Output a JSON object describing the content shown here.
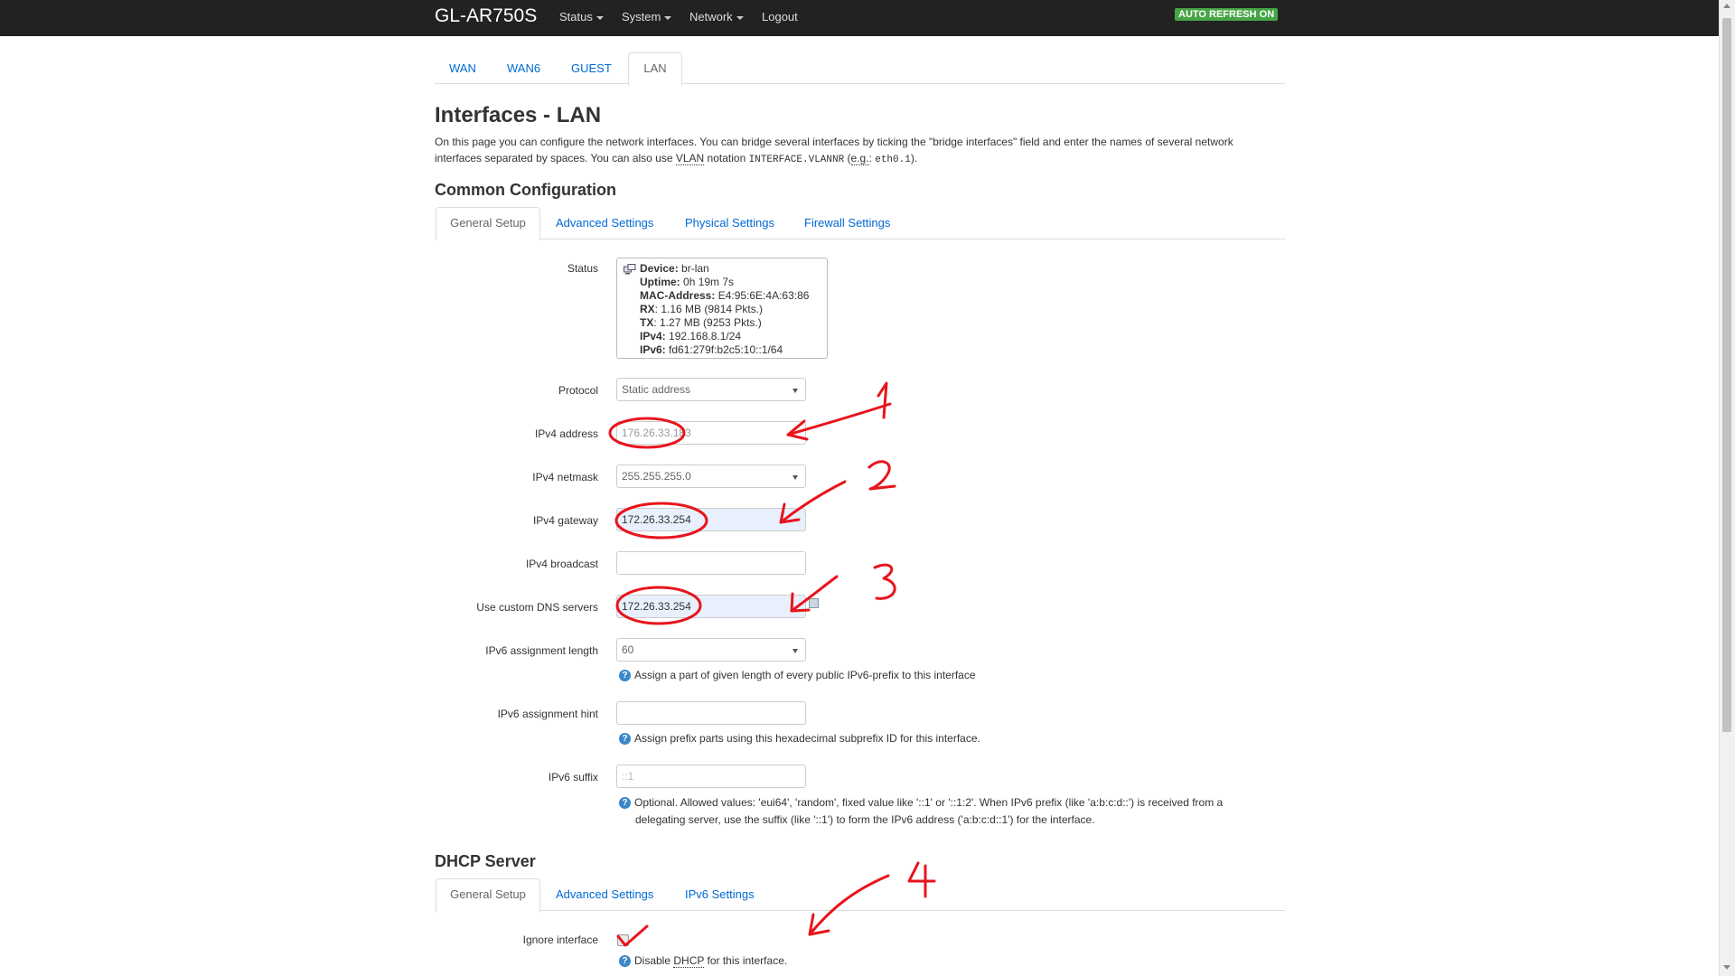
{
  "navbar": {
    "brand": "GL-AR750S",
    "menus": [
      {
        "label": "Status",
        "dropdown": true
      },
      {
        "label": "System",
        "dropdown": true
      },
      {
        "label": "Network",
        "dropdown": true
      },
      {
        "label": "Logout",
        "dropdown": false
      }
    ],
    "auto_refresh": "AUTO REFRESH ON"
  },
  "interface_tabs": [
    "WAN",
    "WAN6",
    "GUEST",
    "LAN"
  ],
  "active_interface_tab": "LAN",
  "page": {
    "title": "Interfaces - LAN",
    "description_1": "On this page you can configure the network interfaces. You can bridge several interfaces by ticking the \"bridge interfaces\" field and enter the names of several network interfaces separated by spaces. You can also use ",
    "vlan_abbr": "VLAN",
    "description_2": " notation ",
    "vlan_code": "INTERFACE.VLANNR",
    "description_3": " (",
    "eg_abbr": "e.g.",
    "description_4": ": ",
    "eg_code": "eth0.1",
    "description_5": ")."
  },
  "common_config": {
    "heading": "Common Configuration",
    "tabs": [
      "General Setup",
      "Advanced Settings",
      "Physical Settings",
      "Firewall Settings"
    ],
    "active_tab": "General Setup"
  },
  "status": {
    "label": "Status",
    "device_label": "Device:",
    "device": "br-lan",
    "uptime_label": "Uptime:",
    "uptime": "0h 19m 7s",
    "mac_label": "MAC-Address:",
    "mac": "E4:95:6E:4A:63:86",
    "rx_label": "RX",
    "rx": ": 1.16 MB (9814 Pkts.)",
    "tx_label": "TX",
    "tx": ": 1.27 MB (9253 Pkts.)",
    "ipv4_label": "IPv4:",
    "ipv4": "192.168.8.1/24",
    "ipv6_label": "IPv6:",
    "ipv6": "fd61:279f:b2c5:10::1/64"
  },
  "fields": {
    "protocol": {
      "label": "Protocol",
      "value": "Static address"
    },
    "ipv4_address": {
      "label": "IPv4 address",
      "value": "176.26.33.183"
    },
    "ipv4_netmask": {
      "label": "IPv4 netmask",
      "value": "255.255.255.0"
    },
    "ipv4_gateway": {
      "label": "IPv4 gateway",
      "value": "172.26.33.254"
    },
    "ipv4_broadcast": {
      "label": "IPv4 broadcast",
      "value": ""
    },
    "custom_dns": {
      "label": "Use custom DNS servers",
      "value": "172.26.33.254"
    },
    "ipv6_assign_length": {
      "label": "IPv6 assignment length",
      "value": "60",
      "hint": "Assign a part of given length of every public IPv6-prefix to this interface"
    },
    "ipv6_assign_hint": {
      "label": "IPv6 assignment hint",
      "value": "",
      "hint": "Assign prefix parts using this hexadecimal subprefix ID for this interface."
    },
    "ipv6_suffix": {
      "label": "IPv6 suffix",
      "placeholder": "::1",
      "hint_1": "Optional. Allowed values: 'eui64', 'random', fixed value like '::1' or '::1:2'. When IPv6 prefix (like 'a:b:c:d::') is received from a",
      "hint_2": "delegating server, use the suffix (like '::1') to form the IPv6 address ('a:b:c:d::1') for the interface."
    }
  },
  "dhcp": {
    "heading": "DHCP Server",
    "tabs": [
      "General Setup",
      "Advanced Settings",
      "IPv6 Settings"
    ],
    "active_tab": "General Setup",
    "ignore_label": "Ignore interface",
    "ignore_checked": false,
    "ignore_hint_pre": "Disable ",
    "ignore_hint_abbr": "DHCP",
    "ignore_hint_post": " for this interface."
  },
  "annotations": {
    "numbers": [
      "1",
      "2",
      "3",
      "4"
    ],
    "color": "#e8141c"
  },
  "colors": {
    "navbar": "#222222",
    "link": "#0069d6",
    "auto_refresh": "#46a546"
  }
}
